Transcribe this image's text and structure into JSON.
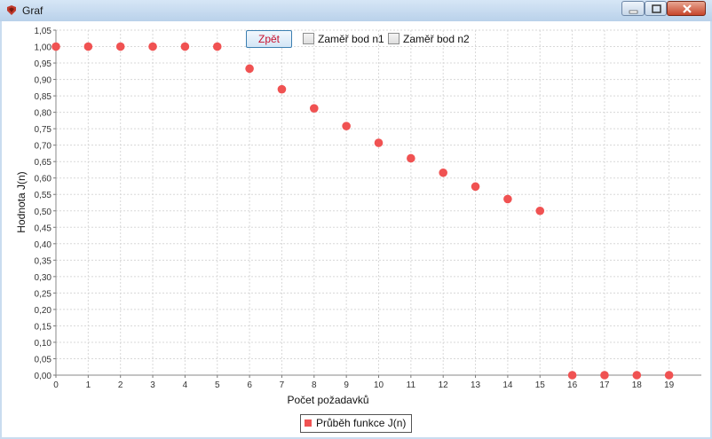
{
  "window": {
    "title": "Graf"
  },
  "controls": {
    "back_label": "Zpět",
    "checkbox_n1_label": "Zaměř bod n1",
    "checkbox_n2_label": "Zaměř bod n2",
    "checkbox_n1_checked": false,
    "checkbox_n2_checked": false
  },
  "colors": {
    "series": "#f05252",
    "grid": "#d8d8d8",
    "back_text": "#c8102e"
  },
  "chart_data": {
    "type": "scatter",
    "xlabel": "Počet požadavků",
    "ylabel": "Hodnota J(n)",
    "xlim": [
      0,
      20
    ],
    "ylim": [
      0,
      1.05
    ],
    "x_ticks": [
      "0",
      "1",
      "2",
      "3",
      "4",
      "5",
      "6",
      "7",
      "8",
      "9",
      "10",
      "11",
      "12",
      "13",
      "14",
      "15",
      "16",
      "17",
      "18",
      "19"
    ],
    "y_ticks": [
      "0,00",
      "0,05",
      "0,10",
      "0,15",
      "0,20",
      "0,25",
      "0,30",
      "0,35",
      "0,40",
      "0,45",
      "0,50",
      "0,55",
      "0,60",
      "0,65",
      "0,70",
      "0,75",
      "0,80",
      "0,85",
      "0,90",
      "0,95",
      "1,00",
      "1,05"
    ],
    "grid": true,
    "legend_position": "bottom-center",
    "series": [
      {
        "name": "Průběh funkce J(n)",
        "x": [
          0,
          1,
          2,
          3,
          4,
          5,
          6,
          7,
          8,
          9,
          10,
          11,
          12,
          13,
          14,
          15,
          16,
          17,
          18,
          19
        ],
        "y": [
          1.0,
          1.0,
          1.0,
          1.0,
          1.0,
          1.0,
          0.933,
          0.87,
          0.812,
          0.758,
          0.707,
          0.66,
          0.616,
          0.574,
          0.536,
          0.5,
          0.0,
          0.0,
          0.0,
          0.0
        ]
      }
    ]
  }
}
